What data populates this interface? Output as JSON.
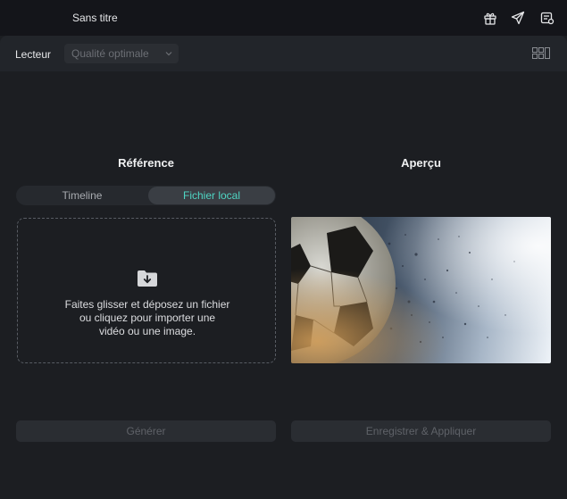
{
  "window": {
    "title": "Sans titre"
  },
  "toolbar": {
    "player_label": "Lecteur",
    "quality_value": "Qualité optimale"
  },
  "reference": {
    "heading": "Référence",
    "tabs": [
      {
        "label": "Timeline",
        "active": false
      },
      {
        "label": "Fichier local",
        "active": true
      }
    ],
    "dropzone": {
      "line1": "Faites glisser et déposez un fichier",
      "line2": "ou cliquez pour importer une",
      "line3": "vidéo ou une image."
    },
    "generate_label": "Générer"
  },
  "preview": {
    "heading": "Aperçu",
    "save_apply_label": "Enregistrer & Appliquer"
  },
  "icons": {
    "gift": "gift-icon",
    "send": "send-icon",
    "settings": "settings-icon",
    "layout": "layout-grid-icon",
    "folder": "folder-download-icon"
  },
  "colors": {
    "accent": "#4fd6c4",
    "background": "#1c1e22",
    "titlebar": "#14151a",
    "toolbar": "#22252a"
  }
}
